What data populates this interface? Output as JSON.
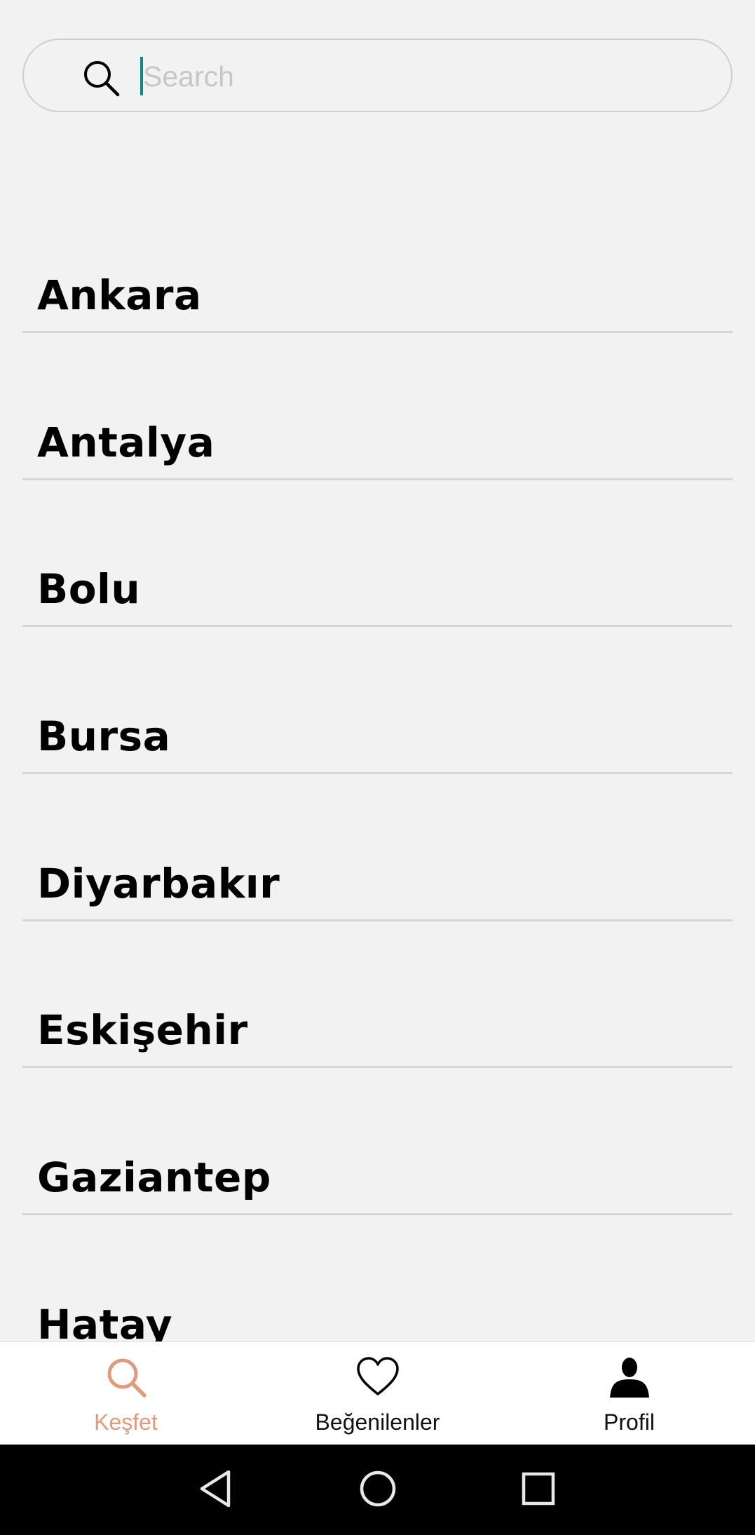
{
  "search": {
    "placeholder": "Search",
    "value": ""
  },
  "cities": [
    {
      "name": "Ankara"
    },
    {
      "name": "Antalya"
    },
    {
      "name": "Bolu"
    },
    {
      "name": "Bursa"
    },
    {
      "name": "Diyarbakır"
    },
    {
      "name": "Eskişehir"
    },
    {
      "name": "Gaziantep"
    },
    {
      "name": "Hatay"
    }
  ],
  "tabs": [
    {
      "label": "Keşfet",
      "icon": "search-icon",
      "active": true
    },
    {
      "label": "Beğenilenler",
      "icon": "heart-icon",
      "active": false
    },
    {
      "label": "Profil",
      "icon": "person-icon",
      "active": false
    }
  ],
  "colors": {
    "background": "#f2f2f2",
    "accent": "#e09a7c",
    "cursor": "#0f8a7e",
    "divider": "#d6d6d6",
    "navbar": "#000000"
  },
  "system_nav": {
    "icons": [
      "back-icon",
      "home-icon",
      "recents-icon"
    ]
  }
}
